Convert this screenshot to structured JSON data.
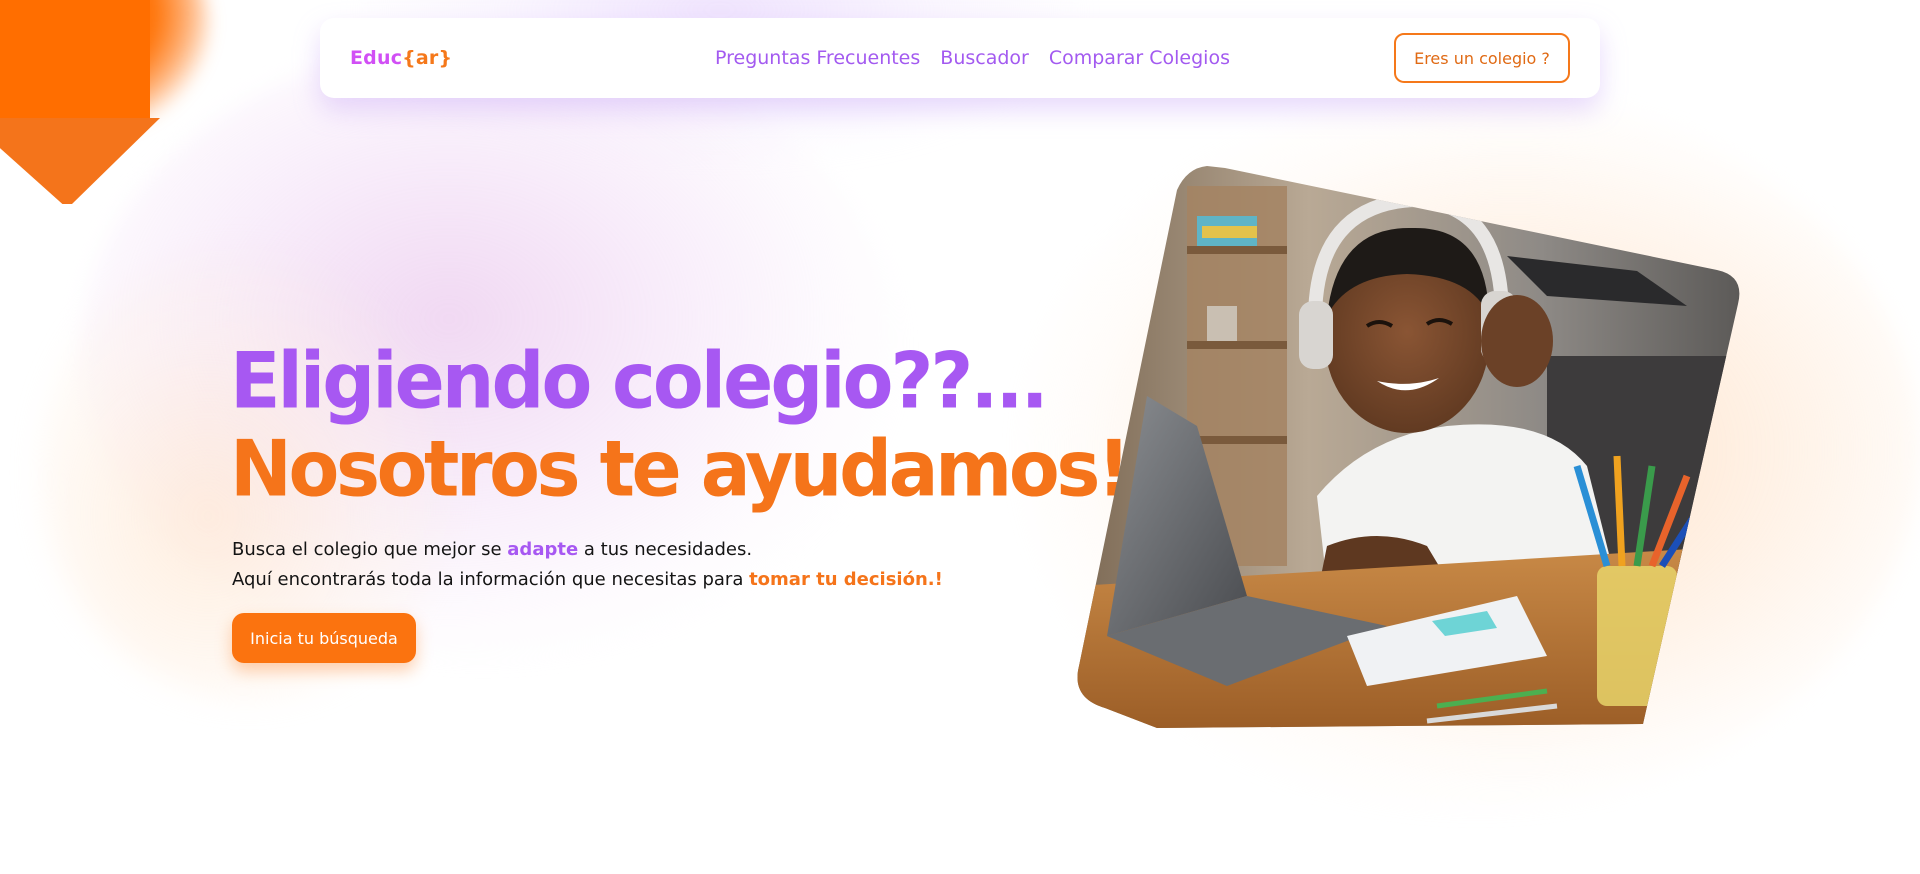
{
  "logo": {
    "part1": "Educ",
    "part2": "{ar}"
  },
  "nav": {
    "links": [
      "Preguntas Frecuentes",
      "Buscador",
      "Comparar Colegios"
    ],
    "cta_label": "Eres un colegio ?"
  },
  "hero": {
    "title_line1": "Eligiendo colegio??...",
    "title_line2": "Nosotros te ayudamos!",
    "text_line1_a": "Busca el colegio que mejor se ",
    "text_line1_highlight": "adapte",
    "text_line1_b": " a tus necesidades.",
    "text_line2_a": "Aquí encontrarás toda la información que necesitas para ",
    "text_line2_highlight": "tomar tu decisión.!",
    "button_label": "Inicia tu búsqueda"
  },
  "colors": {
    "brand_purple": "#a758f2",
    "brand_orange": "#f5741a",
    "logo_pink": "#d14ff5"
  },
  "icons": {
    "hero_image": "child-with-headphones-photo"
  }
}
